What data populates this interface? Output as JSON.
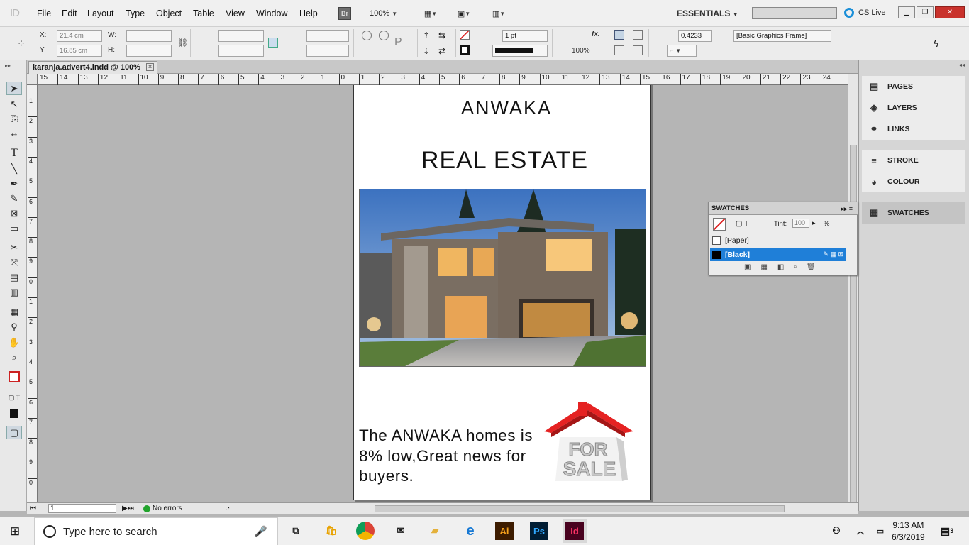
{
  "app": {
    "logo": "ID",
    "bridge_badge": "Br",
    "zoom": "100%"
  },
  "menu": [
    "File",
    "Edit",
    "Layout",
    "Type",
    "Object",
    "Table",
    "View",
    "Window",
    "Help"
  ],
  "workspace": {
    "name": "ESSENTIALS",
    "cs_live": "CS Live"
  },
  "control_panel": {
    "x_label": "X:",
    "x_value": "21.4 cm",
    "y_label": "Y:",
    "y_value": "16.85 cm",
    "w_label": "W:",
    "h_label": "H:",
    "stroke_weight": "1 pt",
    "opacity": "100%",
    "offset": "0.4233 cm",
    "object_style": "[Basic Graphics Frame]",
    "fx_label": "fx."
  },
  "document_tab": {
    "title": "karanja.advert4.indd @ 100%",
    "close": "×"
  },
  "ruler": {
    "horizontal": [
      "15",
      "14",
      "13",
      "12",
      "11",
      "10",
      "9",
      "8",
      "7",
      "6",
      "5",
      "4",
      "3",
      "2",
      "1",
      "0",
      "1",
      "2",
      "3",
      "4",
      "5",
      "6",
      "7",
      "8",
      "9",
      "10",
      "11",
      "12",
      "13",
      "14",
      "15",
      "16",
      "17",
      "18",
      "19",
      "20",
      "21",
      "22",
      "23",
      "24"
    ],
    "vertical": [
      "1",
      "2",
      "3",
      "4",
      "5",
      "6",
      "7",
      "8",
      "9",
      "0",
      "1",
      "2",
      "3",
      "4",
      "5",
      "6",
      "7",
      "8",
      "9",
      "0"
    ]
  },
  "page": {
    "heading1": "ANWAKA",
    "heading2": "REAL ESTATE",
    "body": "The ANWAKA homes is 8% low,Great news for buyers.",
    "sign_line1": "FOR",
    "sign_line2": "SALE"
  },
  "status": {
    "page_number": "1",
    "preflight": "No errors"
  },
  "panels": {
    "group1": [
      {
        "label": "PAGES",
        "icon": "pages-icon"
      },
      {
        "label": "LAYERS",
        "icon": "layers-icon"
      },
      {
        "label": "LINKS",
        "icon": "links-icon"
      }
    ],
    "group2": [
      {
        "label": "STROKE",
        "icon": "stroke-icon"
      },
      {
        "label": "COLOUR",
        "icon": "colour-icon"
      }
    ],
    "group3": [
      {
        "label": "SWATCHES",
        "icon": "swatches-icon"
      }
    ]
  },
  "swatches": {
    "title": "SWATCHES",
    "tint_label": "Tint:",
    "tint_value": "100",
    "tint_unit": "%",
    "items": [
      {
        "name": "[Paper]",
        "color": "#ffffff"
      },
      {
        "name": "[Black]",
        "color": "#000000"
      }
    ]
  },
  "taskbar": {
    "search_placeholder": "Type here to search",
    "time": "9:13 AM",
    "date": "6/3/2019",
    "notifications": "3"
  },
  "colors": {
    "accent_blue": "#1f7fd8",
    "close_red": "#c9322c",
    "indesign_pink": "#ff3366"
  }
}
